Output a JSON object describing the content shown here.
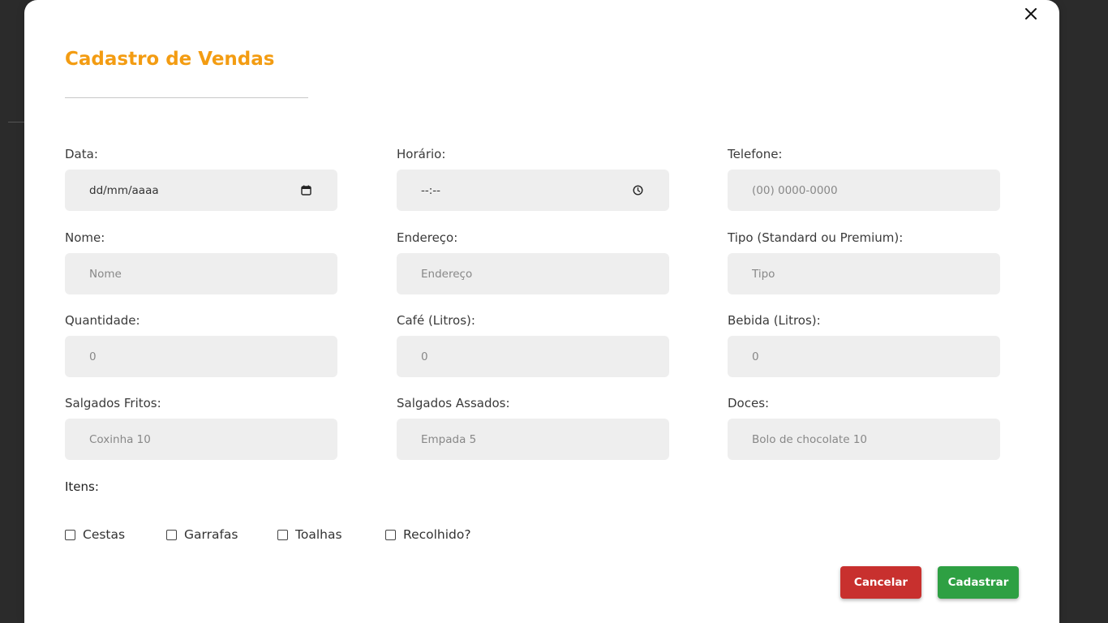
{
  "modal": {
    "title": "Cadastro de Vendas",
    "close_icon": "close-icon"
  },
  "fields": {
    "data": {
      "label": "Data:",
      "value": "dd/mm/aaaa",
      "icon": "calendar-icon"
    },
    "horario": {
      "label": "Horário:",
      "value": "--:--",
      "icon": "clock-icon"
    },
    "telefone": {
      "label": "Telefone:",
      "placeholder": "(00) 0000-0000"
    },
    "nome": {
      "label": "Nome:",
      "placeholder": "Nome"
    },
    "endereco": {
      "label": "Endereço:",
      "placeholder": "Endereço"
    },
    "tipo": {
      "label": "Tipo (Standard ou Premium):",
      "placeholder": "Tipo"
    },
    "quantidade": {
      "label": "Quantidade:",
      "placeholder": "0"
    },
    "cafe": {
      "label": "Café (Litros):",
      "placeholder": "0"
    },
    "bebida": {
      "label": "Bebida (Litros):",
      "placeholder": "0"
    },
    "salgados_fritos": {
      "label": "Salgados Fritos:",
      "placeholder": "Coxinha 10"
    },
    "salgados_assados": {
      "label": "Salgados Assados:",
      "placeholder": "Empada 5"
    },
    "doces": {
      "label": "Doces:",
      "placeholder": "Bolo de chocolate 10"
    }
  },
  "itens": {
    "label": "Itens:",
    "options": [
      "Cestas",
      "Garrafas",
      "Toalhas",
      "Recolhido?"
    ]
  },
  "buttons": {
    "cancel": "Cancelar",
    "submit": "Cadastrar"
  },
  "colors": {
    "title": "#f39c12",
    "cancel": "#c8302e",
    "submit": "#2ea043",
    "input_bg": "#eeeeee"
  }
}
